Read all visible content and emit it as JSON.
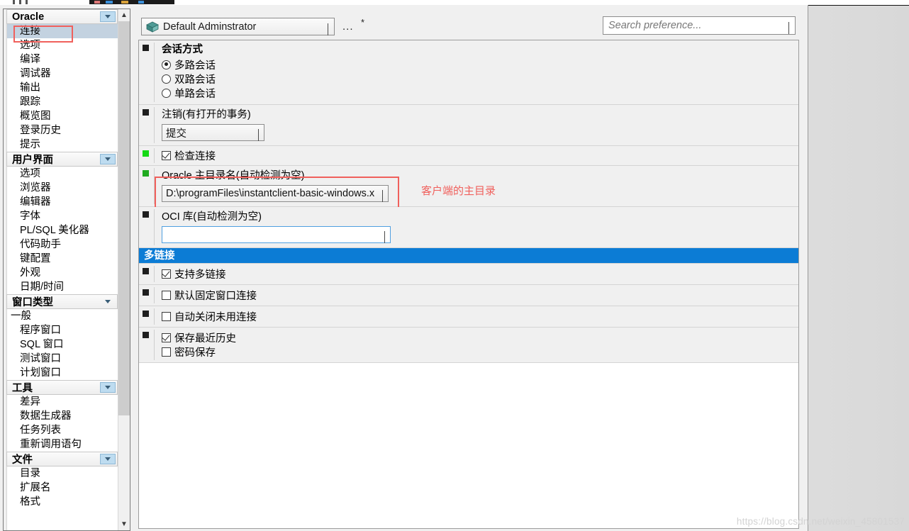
{
  "window": {
    "watermark": "https://blog.csdn.net/weixin_45801537"
  },
  "toolbar": {
    "profile_icon": "package-icon",
    "profile_value": "Default Adminstrator",
    "more_button": "...",
    "modified_marker": "*",
    "search_placeholder": "Search preference...",
    "dropdown_icon": "chevron-down-icon"
  },
  "sidebar": {
    "groups": [
      {
        "title": "Oracle",
        "expand_icon": "chevron-down-icon",
        "has_button": true,
        "items": [
          {
            "label": "连接",
            "selected": true,
            "annotated": true
          },
          {
            "label": "选项",
            "selected": false
          },
          {
            "label": "编译",
            "selected": false
          },
          {
            "label": "调试器",
            "selected": false
          },
          {
            "label": "输出",
            "selected": false
          },
          {
            "label": "跟踪",
            "selected": false
          },
          {
            "label": "概览图",
            "selected": false
          },
          {
            "label": "登录历史",
            "selected": false
          },
          {
            "label": "提示",
            "selected": false
          }
        ]
      },
      {
        "title": "用户界面",
        "expand_icon": "chevron-down-icon",
        "has_button": true,
        "items": [
          {
            "label": "选项",
            "selected": false
          },
          {
            "label": "浏览器",
            "selected": false
          },
          {
            "label": "编辑器",
            "selected": false
          },
          {
            "label": "字体",
            "selected": false
          },
          {
            "label": "PL/SQL 美化器",
            "selected": false
          },
          {
            "label": "代码助手",
            "selected": false
          },
          {
            "label": "键配置",
            "selected": false
          },
          {
            "label": "外观",
            "selected": false
          },
          {
            "label": "日期/时间",
            "selected": false
          }
        ]
      },
      {
        "title": "窗口类型",
        "expand_icon": "chevron-down-icon",
        "has_button": false,
        "items": [
          {
            "label": "一般",
            "selected": false,
            "dash": true
          },
          {
            "label": "程序窗口",
            "selected": false
          },
          {
            "label": "SQL 窗口",
            "selected": false
          },
          {
            "label": "测试窗口",
            "selected": false
          },
          {
            "label": "计划窗口",
            "selected": false
          }
        ]
      },
      {
        "title": "工具",
        "expand_icon": "chevron-down-icon",
        "has_button": true,
        "items": [
          {
            "label": "差异",
            "selected": false
          },
          {
            "label": "数据生成器",
            "selected": false
          },
          {
            "label": "任务列表",
            "selected": false
          },
          {
            "label": "重新调用语句",
            "selected": false
          }
        ]
      },
      {
        "title": "文件",
        "expand_icon": "chevron-down-icon",
        "has_button": true,
        "items": [
          {
            "label": "目录",
            "selected": false
          },
          {
            "label": "扩展名",
            "selected": false
          },
          {
            "label": "格式",
            "selected": false
          }
        ]
      }
    ],
    "scroll_up_icon": "chevron-up-icon",
    "scroll_down_icon": "chevron-down-icon"
  },
  "settings": {
    "session_mode": {
      "heading": "会话方式",
      "marker": "black",
      "options": [
        {
          "label": "多路会话",
          "checked": true
        },
        {
          "label": "双路会话",
          "checked": false
        },
        {
          "label": "单路会话",
          "checked": false
        }
      ]
    },
    "logoff": {
      "label": "注销(有打开的事务)",
      "marker": "black",
      "value": "提交",
      "dropdown_icon": "chevron-down-icon"
    },
    "check_connection": {
      "label": "检查连接",
      "marker": "green",
      "checked": true
    },
    "oracle_home": {
      "label": "Oracle 主目录名(自动检测为空)",
      "marker": "green",
      "value": "D:\\programFiles\\instantclient-basic-windows.x",
      "dropdown_icon": "chevron-down-icon",
      "annotation": "客户端的主目录"
    },
    "oci_library": {
      "label": "OCI 库(自动检测为空)",
      "marker": "black",
      "value": "",
      "dropdown_icon": "chevron-down-icon"
    },
    "multilink_header": "多链接",
    "multilink": [
      {
        "label": "支持多链接",
        "checked": true,
        "marker": "black"
      },
      {
        "label": "默认固定窗口连接",
        "checked": false,
        "marker": "black"
      },
      {
        "label": "自动关闭未用连接",
        "checked": false,
        "marker": "black"
      }
    ],
    "history": {
      "marker": "black",
      "items": [
        {
          "label": "保存最近历史",
          "checked": true
        },
        {
          "label": "密码保存",
          "checked": false
        }
      ]
    }
  }
}
